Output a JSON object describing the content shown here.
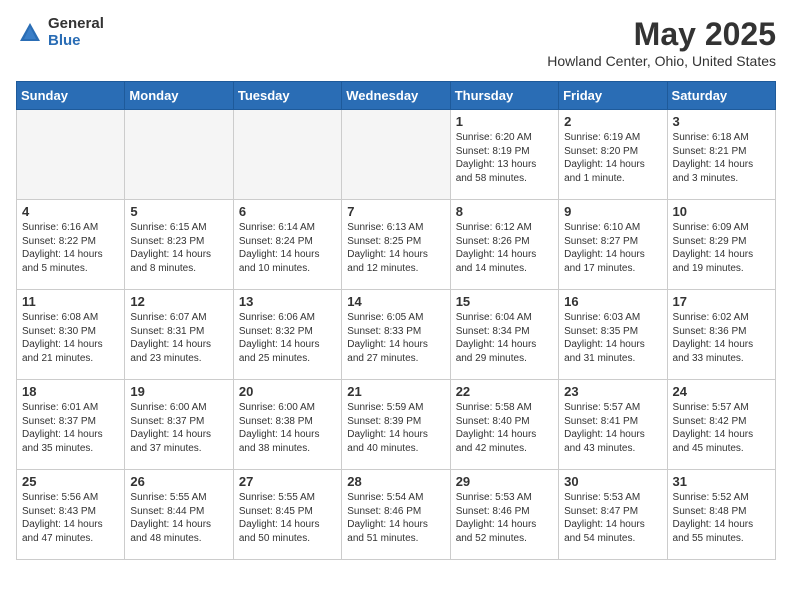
{
  "header": {
    "logo_line1": "General",
    "logo_line2": "Blue",
    "title": "May 2025",
    "subtitle": "Howland Center, Ohio, United States"
  },
  "days_of_week": [
    "Sunday",
    "Monday",
    "Tuesday",
    "Wednesday",
    "Thursday",
    "Friday",
    "Saturday"
  ],
  "weeks": [
    [
      {
        "day": "",
        "info": ""
      },
      {
        "day": "",
        "info": ""
      },
      {
        "day": "",
        "info": ""
      },
      {
        "day": "",
        "info": ""
      },
      {
        "day": "1",
        "info": "Sunrise: 6:20 AM\nSunset: 8:19 PM\nDaylight: 13 hours\nand 58 minutes."
      },
      {
        "day": "2",
        "info": "Sunrise: 6:19 AM\nSunset: 8:20 PM\nDaylight: 14 hours\nand 1 minute."
      },
      {
        "day": "3",
        "info": "Sunrise: 6:18 AM\nSunset: 8:21 PM\nDaylight: 14 hours\nand 3 minutes."
      }
    ],
    [
      {
        "day": "4",
        "info": "Sunrise: 6:16 AM\nSunset: 8:22 PM\nDaylight: 14 hours\nand 5 minutes."
      },
      {
        "day": "5",
        "info": "Sunrise: 6:15 AM\nSunset: 8:23 PM\nDaylight: 14 hours\nand 8 minutes."
      },
      {
        "day": "6",
        "info": "Sunrise: 6:14 AM\nSunset: 8:24 PM\nDaylight: 14 hours\nand 10 minutes."
      },
      {
        "day": "7",
        "info": "Sunrise: 6:13 AM\nSunset: 8:25 PM\nDaylight: 14 hours\nand 12 minutes."
      },
      {
        "day": "8",
        "info": "Sunrise: 6:12 AM\nSunset: 8:26 PM\nDaylight: 14 hours\nand 14 minutes."
      },
      {
        "day": "9",
        "info": "Sunrise: 6:10 AM\nSunset: 8:27 PM\nDaylight: 14 hours\nand 17 minutes."
      },
      {
        "day": "10",
        "info": "Sunrise: 6:09 AM\nSunset: 8:29 PM\nDaylight: 14 hours\nand 19 minutes."
      }
    ],
    [
      {
        "day": "11",
        "info": "Sunrise: 6:08 AM\nSunset: 8:30 PM\nDaylight: 14 hours\nand 21 minutes."
      },
      {
        "day": "12",
        "info": "Sunrise: 6:07 AM\nSunset: 8:31 PM\nDaylight: 14 hours\nand 23 minutes."
      },
      {
        "day": "13",
        "info": "Sunrise: 6:06 AM\nSunset: 8:32 PM\nDaylight: 14 hours\nand 25 minutes."
      },
      {
        "day": "14",
        "info": "Sunrise: 6:05 AM\nSunset: 8:33 PM\nDaylight: 14 hours\nand 27 minutes."
      },
      {
        "day": "15",
        "info": "Sunrise: 6:04 AM\nSunset: 8:34 PM\nDaylight: 14 hours\nand 29 minutes."
      },
      {
        "day": "16",
        "info": "Sunrise: 6:03 AM\nSunset: 8:35 PM\nDaylight: 14 hours\nand 31 minutes."
      },
      {
        "day": "17",
        "info": "Sunrise: 6:02 AM\nSunset: 8:36 PM\nDaylight: 14 hours\nand 33 minutes."
      }
    ],
    [
      {
        "day": "18",
        "info": "Sunrise: 6:01 AM\nSunset: 8:37 PM\nDaylight: 14 hours\nand 35 minutes."
      },
      {
        "day": "19",
        "info": "Sunrise: 6:00 AM\nSunset: 8:37 PM\nDaylight: 14 hours\nand 37 minutes."
      },
      {
        "day": "20",
        "info": "Sunrise: 6:00 AM\nSunset: 8:38 PM\nDaylight: 14 hours\nand 38 minutes."
      },
      {
        "day": "21",
        "info": "Sunrise: 5:59 AM\nSunset: 8:39 PM\nDaylight: 14 hours\nand 40 minutes."
      },
      {
        "day": "22",
        "info": "Sunrise: 5:58 AM\nSunset: 8:40 PM\nDaylight: 14 hours\nand 42 minutes."
      },
      {
        "day": "23",
        "info": "Sunrise: 5:57 AM\nSunset: 8:41 PM\nDaylight: 14 hours\nand 43 minutes."
      },
      {
        "day": "24",
        "info": "Sunrise: 5:57 AM\nSunset: 8:42 PM\nDaylight: 14 hours\nand 45 minutes."
      }
    ],
    [
      {
        "day": "25",
        "info": "Sunrise: 5:56 AM\nSunset: 8:43 PM\nDaylight: 14 hours\nand 47 minutes."
      },
      {
        "day": "26",
        "info": "Sunrise: 5:55 AM\nSunset: 8:44 PM\nDaylight: 14 hours\nand 48 minutes."
      },
      {
        "day": "27",
        "info": "Sunrise: 5:55 AM\nSunset: 8:45 PM\nDaylight: 14 hours\nand 50 minutes."
      },
      {
        "day": "28",
        "info": "Sunrise: 5:54 AM\nSunset: 8:46 PM\nDaylight: 14 hours\nand 51 minutes."
      },
      {
        "day": "29",
        "info": "Sunrise: 5:53 AM\nSunset: 8:46 PM\nDaylight: 14 hours\nand 52 minutes."
      },
      {
        "day": "30",
        "info": "Sunrise: 5:53 AM\nSunset: 8:47 PM\nDaylight: 14 hours\nand 54 minutes."
      },
      {
        "day": "31",
        "info": "Sunrise: 5:52 AM\nSunset: 8:48 PM\nDaylight: 14 hours\nand 55 minutes."
      }
    ]
  ]
}
